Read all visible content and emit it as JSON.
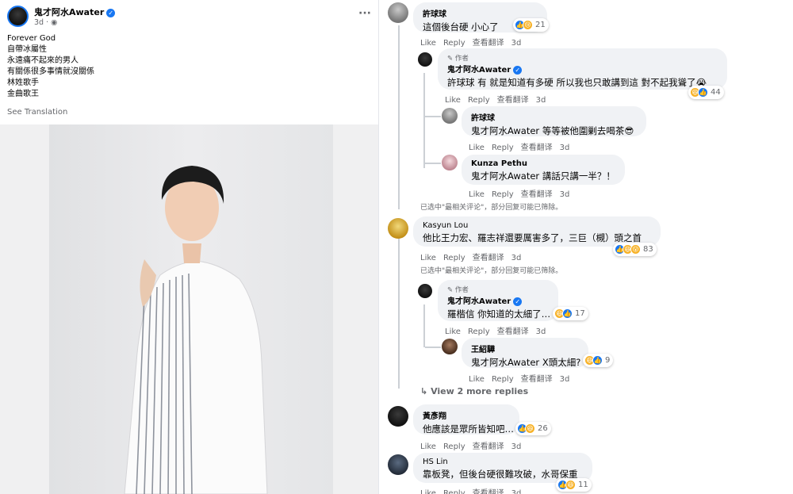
{
  "post": {
    "author": "鬼才阿水Awater",
    "time": "3d ·",
    "lines": [
      "Forever God",
      "自帶冰屬性",
      "永遠痛不起來的男人",
      "有關係很多事情就沒關係",
      "林姓歌手",
      "金曲歌王"
    ],
    "see_translation": "See Translation",
    "more": "···"
  },
  "labels": {
    "like": "Like",
    "reply": "Reply",
    "translate": "查看翻译",
    "author_tag": "作者",
    "filter_note": "已选中\"最相关评论\"，部分回复可能已筛除。",
    "view_more": "View 2 more replies"
  },
  "comments": [
    {
      "name": "許球球",
      "text": "這個後台硬 小心了",
      "time": "3d",
      "count": "21"
    },
    {
      "name": "鬼才阿水Awater",
      "text": "許球球 有 就是知道有多硬 所以我也只敢講到這 對不起我聳了😭",
      "time": "3d",
      "count": "44"
    },
    {
      "name": "許球球",
      "text": "鬼才阿水Awater 等等被他圍剿去喝茶😎",
      "time": "3d"
    },
    {
      "name": "Kunza Pethu",
      "text": "鬼才阿水Awater 講話只講一半？！",
      "time": "3d"
    },
    {
      "name": "Kasyun Lou",
      "text": "他比王力宏、羅志祥還要厲害多了，三巨（槻）頭之首",
      "time": "3d",
      "count": "83"
    },
    {
      "name": "鬼才阿水Awater",
      "text": "羅楷信 你知道的太細了…",
      "time": "3d",
      "count": "17"
    },
    {
      "name": "王紹驊",
      "text": "鬼才阿水Awater X頭太細?",
      "time": "3d",
      "count": "9"
    },
    {
      "name": "黃彥翔",
      "text": "他應該是眾所皆知吧…",
      "time": "3d",
      "count": "26"
    },
    {
      "name": "HS Lin",
      "text": "靠板凳，但後台硬很難攻破，水哥保重",
      "time": "3d",
      "count": "11"
    }
  ],
  "colors": {
    "accent": "#1877f2",
    "bubble": "#f0f2f5",
    "muted": "#65676b"
  }
}
